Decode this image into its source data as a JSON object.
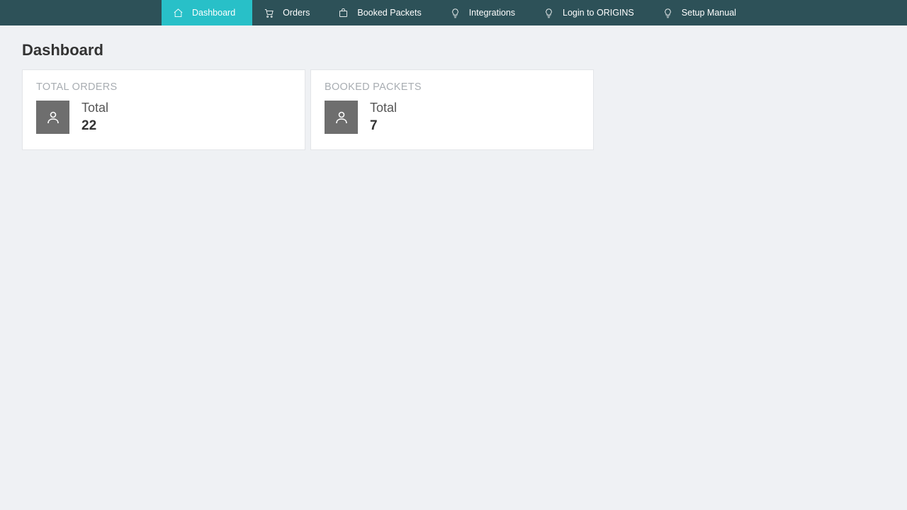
{
  "nav": {
    "items": [
      {
        "label": "Dashboard",
        "icon": "home"
      },
      {
        "label": "Orders",
        "icon": "cart"
      },
      {
        "label": "Booked Packets",
        "icon": "bag"
      },
      {
        "label": "Integrations",
        "icon": "bulb"
      },
      {
        "label": "Login to ORIGINS",
        "icon": "bulb"
      },
      {
        "label": "Setup Manual",
        "icon": "bulb"
      }
    ],
    "active_index": 0
  },
  "page": {
    "title": "Dashboard"
  },
  "cards": [
    {
      "title": "TOTAL ORDERS",
      "label": "Total",
      "value": "22"
    },
    {
      "title": "BOOKED PACKETS",
      "label": "Total",
      "value": "7"
    }
  ]
}
